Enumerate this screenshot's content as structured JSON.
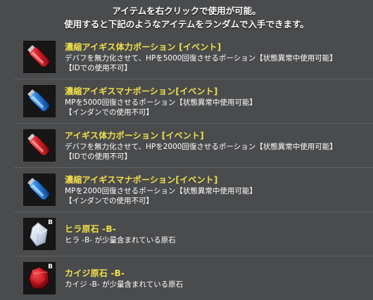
{
  "header": {
    "line1": "アイテムを右クリックで使用が可能。",
    "line2": "使用すると下記のようなアイテムをランダムで入手できます。"
  },
  "items": [
    {
      "name": "濃縮アイギス体力ポーション [イベント]",
      "desc1": "デバフを無力化させて、HPを5000回復させるポーション【状態異常中使用可能】",
      "desc2": "【IDでの使用不可】",
      "icon": "red-potion-icon",
      "color": "#d8202a"
    },
    {
      "name": "濃縮アイギスマナポーション[イベント]",
      "desc1": "MPを5000回復させるポーション【状態異常中使用可能】",
      "desc2": "【インダンでの使用不可】",
      "icon": "blue-potion-icon",
      "color": "#2a7fe0"
    },
    {
      "name": "アイギス体力ポーション [イベント]",
      "desc1": "デバフを無力化させて、HPを2000回復させるポーション【状態異常中使用可能】",
      "desc2": "【IDでの使用不可】",
      "icon": "red-potion-icon",
      "color": "#d8202a"
    },
    {
      "name": "濃縮アイギスマナポーション[イベント]",
      "desc1": "MPを2000回復させるポーション【状態異常中使用可能】",
      "desc2": "【インダンでの使用不可】",
      "icon": "blue-potion-icon",
      "color": "#2a7fe0"
    },
    {
      "name": "ヒラ原石 -B-",
      "desc1": "ヒラ -B- が少量含まれている原石",
      "desc2": "",
      "icon": "white-crystal-icon",
      "badge": "B",
      "color": "#dfe8f4"
    },
    {
      "name": "カイジ原石 -B-",
      "desc1": "カイジ -B- が少量含まれている原石",
      "desc2": "",
      "icon": "red-gem-icon",
      "badge": "B",
      "color": "#c2161c"
    }
  ]
}
